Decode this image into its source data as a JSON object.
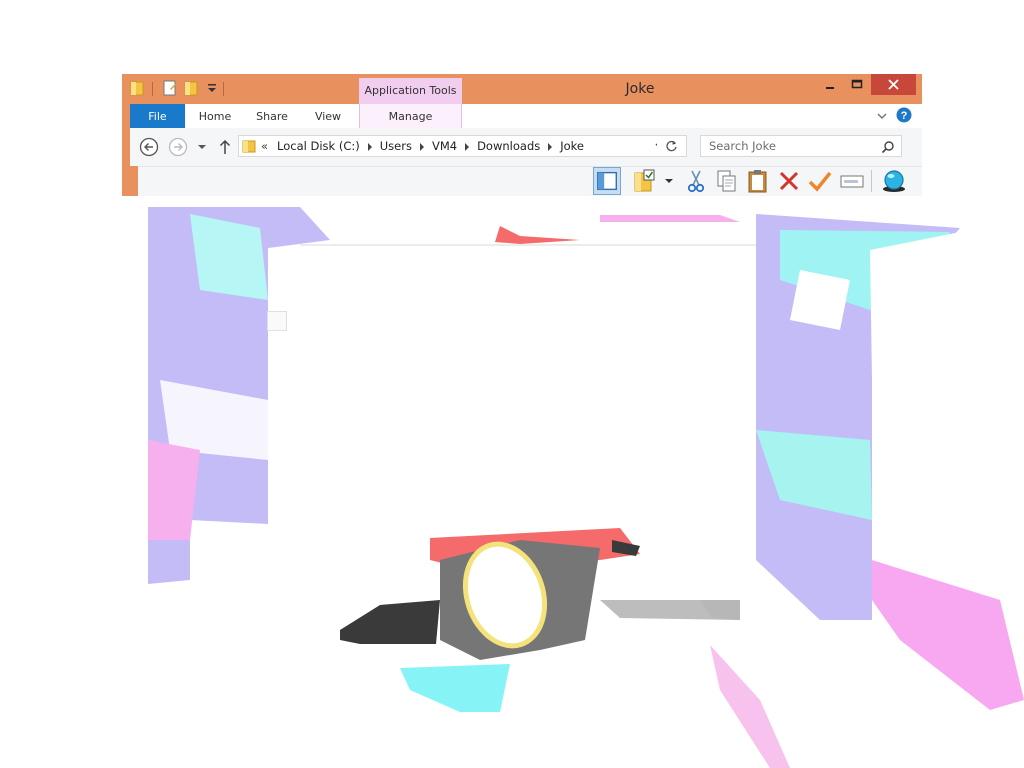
{
  "window": {
    "title": "Joke",
    "context_tab_header": "Application Tools",
    "caption_buttons": [
      "minimize-icon",
      "maximize-icon",
      "close-icon"
    ]
  },
  "ribbon": {
    "tabs": [
      {
        "label": "File"
      },
      {
        "label": "Home"
      },
      {
        "label": "Share"
      },
      {
        "label": "View"
      },
      {
        "label": "Manage"
      }
    ]
  },
  "address": {
    "overflow": "«",
    "breadcrumb": [
      "Local Disk (C:)",
      "Users",
      "VM4",
      "Downloads",
      "Joke"
    ]
  },
  "search": {
    "placeholder": "Search Joke"
  },
  "toolbar": {
    "icons": [
      "preview-pane-icon",
      "select-folder-icon",
      "cut-icon",
      "copy-icon",
      "paste-icon",
      "delete-icon",
      "checkmark-icon",
      "rename-icon",
      "globe-icon"
    ]
  },
  "colors": {
    "titlebar": "#e8915f",
    "file_tab": "#1979ca",
    "context_tab": "#f1cdf0",
    "close_button": "#c7483a",
    "artwork_lavender": "#c3bcf7",
    "artwork_cyan": "#96f4f4",
    "artwork_pink": "#f9b1ee",
    "artwork_red": "#f56a6a",
    "artwork_gray": "#7a7a7a"
  }
}
